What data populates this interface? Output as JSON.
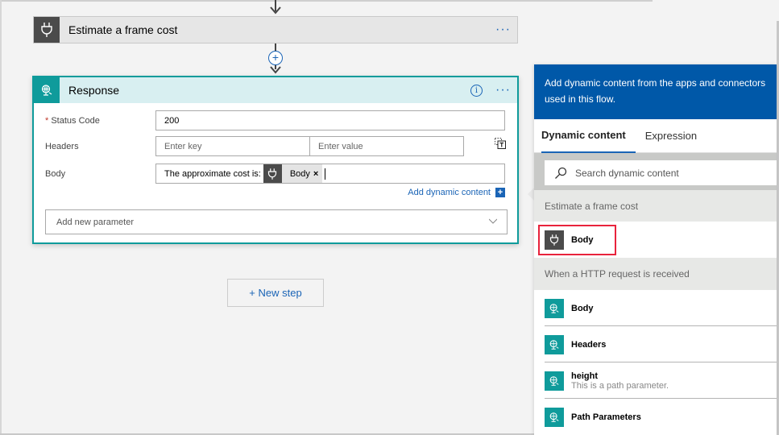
{
  "flow": {
    "estimate_card": {
      "title": "Estimate a frame cost",
      "more_label": "···"
    },
    "response_card": {
      "title": "Response",
      "more_label": "···",
      "fields": {
        "status_code": {
          "label": "Status Code",
          "required_mark": "*",
          "value": "200"
        },
        "headers": {
          "label": "Headers",
          "key_placeholder": "Enter key",
          "value_placeholder": "Enter value"
        },
        "body": {
          "label": "Body",
          "text": "The approximate cost is:",
          "token_label": "Body",
          "token_remove": "×"
        }
      },
      "add_dynamic_content": "Add dynamic content",
      "add_dynamic_plus": "+",
      "add_new_parameter": "Add new parameter"
    },
    "new_step_label": "+ New step",
    "insert_step_symbol": "+"
  },
  "dynamic_panel": {
    "banner": "Add dynamic content from the apps and connectors used in this flow.",
    "banner_line1": "Add dynamic content from the apps and connectors",
    "banner_line2": "used in this flow.",
    "tabs": [
      {
        "label": "Dynamic content",
        "active": true
      },
      {
        "label": "Expression",
        "active": false
      }
    ],
    "search_placeholder": "Search dynamic content",
    "sections": [
      {
        "title": "Estimate a frame cost",
        "items": [
          {
            "name": "Body",
            "icon": "plug-icon",
            "highlighted": true
          }
        ]
      },
      {
        "title": "When a HTTP request is received",
        "items": [
          {
            "name": "Body",
            "icon": "globe-icon"
          },
          {
            "name": "Headers",
            "icon": "globe-icon"
          },
          {
            "name": "height",
            "description": "This is a path parameter.",
            "icon": "globe-icon"
          },
          {
            "name": "Path Parameters",
            "icon": "globe-icon"
          }
        ]
      }
    ]
  },
  "colors": {
    "accent_blue": "#1a64b6",
    "banner_blue": "#0058a8",
    "teal": "#0f9b9b",
    "highlight_red": "#e8233c",
    "dark_icon": "#4b4b4b"
  }
}
